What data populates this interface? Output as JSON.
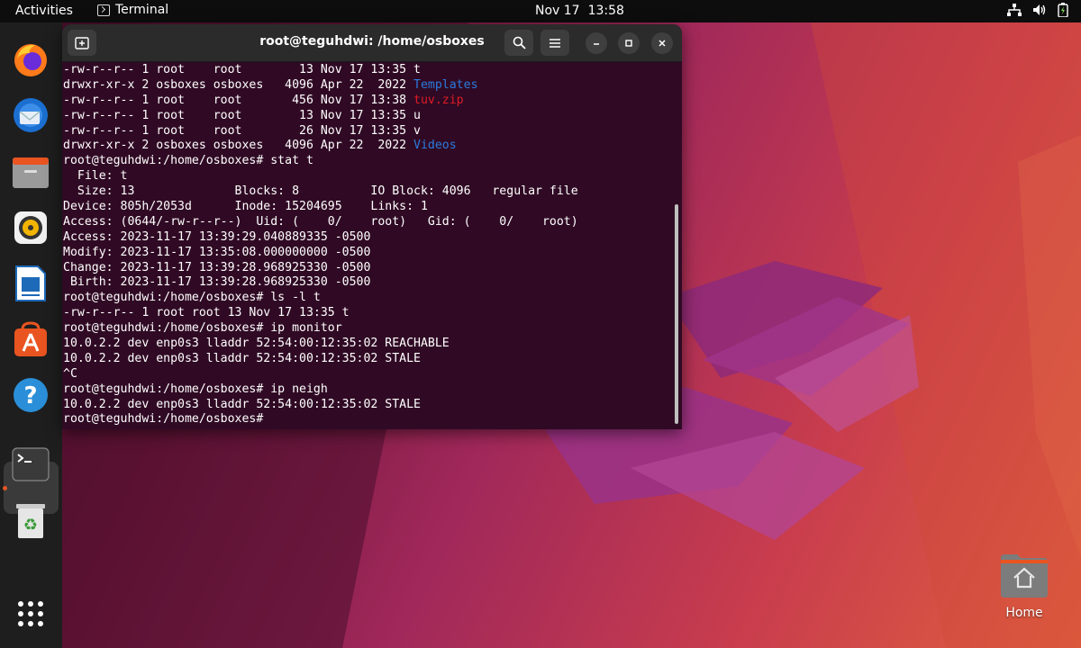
{
  "topbar": {
    "activities": "Activities",
    "app_name": "Terminal",
    "date": "Nov 17",
    "time": "13:58",
    "tray_icons": [
      "network-icon",
      "volume-icon",
      "battery-icon"
    ]
  },
  "dock": {
    "items": [
      {
        "name": "firefox",
        "icon": "firefox-icon"
      },
      {
        "name": "thunderbird",
        "icon": "thunderbird-icon"
      },
      {
        "name": "files",
        "icon": "files-icon"
      },
      {
        "name": "rhythmbox",
        "icon": "rhythmbox-icon"
      },
      {
        "name": "libreoffice-writer",
        "icon": "writer-icon"
      },
      {
        "name": "app-center",
        "icon": "app-center-icon"
      },
      {
        "name": "help",
        "icon": "help-icon"
      },
      {
        "name": "terminal",
        "icon": "terminal-icon",
        "active": true
      },
      {
        "name": "trash",
        "icon": "trash-icon"
      },
      {
        "name": "show-apps",
        "icon": "grid-icon"
      }
    ],
    "accent": "#e95420"
  },
  "terminal": {
    "title": "root@teguhdwi: /home/osboxes",
    "colors": {
      "background": "#300a24",
      "directory": "#2a7bde",
      "archive": "#e01b24",
      "text": "#ffffff"
    },
    "lines": [
      {
        "text": "-rw-r--r-- 1 root    root        13 Nov 17 13:35 ",
        "tail": "t",
        "tail_class": ""
      },
      {
        "text": "drwxr-xr-x 2 osboxes osboxes   4096 Apr 22  2022 ",
        "tail": "Templates",
        "tail_class": "dir"
      },
      {
        "text": "-rw-r--r-- 1 root    root       456 Nov 17 13:38 ",
        "tail": "tuv.zip",
        "tail_class": "zip"
      },
      {
        "text": "-rw-r--r-- 1 root    root        13 Nov 17 13:35 ",
        "tail": "u",
        "tail_class": ""
      },
      {
        "text": "-rw-r--r-- 1 root    root        26 Nov 17 13:35 ",
        "tail": "v",
        "tail_class": ""
      },
      {
        "text": "drwxr-xr-x 2 osboxes osboxes   4096 Apr 22  2022 ",
        "tail": "Videos",
        "tail_class": "dir"
      },
      {
        "text": "root@teguhdwi:/home/osboxes# stat t",
        "tail": "",
        "tail_class": ""
      },
      {
        "text": "  File: t",
        "tail": "",
        "tail_class": ""
      },
      {
        "text": "  Size: 13              Blocks: 8          IO Block: 4096   regular file",
        "tail": "",
        "tail_class": ""
      },
      {
        "text": "Device: 805h/2053d      Inode: 15204695    Links: 1",
        "tail": "",
        "tail_class": ""
      },
      {
        "text": "Access: (0644/-rw-r--r--)  Uid: (    0/    root)   Gid: (    0/    root)",
        "tail": "",
        "tail_class": ""
      },
      {
        "text": "Access: 2023-11-17 13:39:29.040889335 -0500",
        "tail": "",
        "tail_class": ""
      },
      {
        "text": "Modify: 2023-11-17 13:35:08.000000000 -0500",
        "tail": "",
        "tail_class": ""
      },
      {
        "text": "Change: 2023-11-17 13:39:28.968925330 -0500",
        "tail": "",
        "tail_class": ""
      },
      {
        "text": " Birth: 2023-11-17 13:39:28.968925330 -0500",
        "tail": "",
        "tail_class": ""
      },
      {
        "text": "root@teguhdwi:/home/osboxes# ls -l t",
        "tail": "",
        "tail_class": ""
      },
      {
        "text": "-rw-r--r-- 1 root root 13 Nov 17 13:35 t",
        "tail": "",
        "tail_class": ""
      },
      {
        "text": "root@teguhdwi:/home/osboxes# ip monitor",
        "tail": "",
        "tail_class": ""
      },
      {
        "text": "10.0.2.2 dev enp0s3 lladdr 52:54:00:12:35:02 REACHABLE",
        "tail": "",
        "tail_class": ""
      },
      {
        "text": "10.0.2.2 dev enp0s3 lladdr 52:54:00:12:35:02 STALE",
        "tail": "",
        "tail_class": ""
      },
      {
        "text": "^C",
        "tail": "",
        "tail_class": ""
      },
      {
        "text": "root@teguhdwi:/home/osboxes# ip neigh",
        "tail": "",
        "tail_class": ""
      },
      {
        "text": "10.0.2.2 dev enp0s3 lladdr 52:54:00:12:35:02 STALE",
        "tail": "",
        "tail_class": ""
      },
      {
        "text": "root@teguhdwi:/home/osboxes# ",
        "tail": "",
        "tail_class": ""
      }
    ]
  },
  "desktop": {
    "home_label": "Home"
  }
}
